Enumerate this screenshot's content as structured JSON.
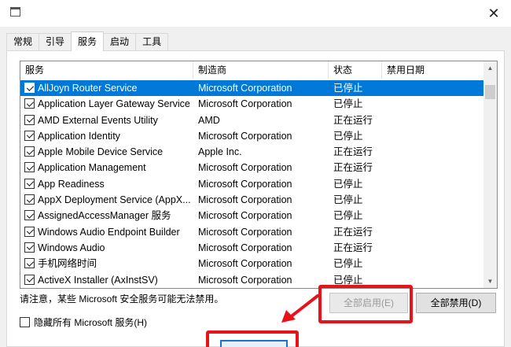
{
  "window": {
    "close_glyph": "✕"
  },
  "tabs": [
    {
      "label": "常规"
    },
    {
      "label": "引导"
    },
    {
      "label": "服务"
    },
    {
      "label": "启动"
    },
    {
      "label": "工具"
    }
  ],
  "columns": {
    "service": "服务",
    "manufacturer": "制造商",
    "status": "状态",
    "disabled_date": "禁用日期"
  },
  "services": [
    {
      "name": "AllJoyn Router Service",
      "maker": "Microsoft Corporation",
      "status": "已停止",
      "date": "",
      "checked": true
    },
    {
      "name": "Application Layer Gateway Service",
      "maker": "Microsoft Corporation",
      "status": "已停止",
      "date": "",
      "checked": true
    },
    {
      "name": "AMD External Events Utility",
      "maker": "AMD",
      "status": "正在运行",
      "date": "",
      "checked": true
    },
    {
      "name": "Application Identity",
      "maker": "Microsoft Corporation",
      "status": "已停止",
      "date": "",
      "checked": true
    },
    {
      "name": "Apple Mobile Device Service",
      "maker": "Apple Inc.",
      "status": "正在运行",
      "date": "",
      "checked": true
    },
    {
      "name": "Application Management",
      "maker": "Microsoft Corporation",
      "status": "正在运行",
      "date": "",
      "checked": true
    },
    {
      "name": "App Readiness",
      "maker": "Microsoft Corporation",
      "status": "已停止",
      "date": "",
      "checked": true
    },
    {
      "name": "AppX Deployment Service (AppX...",
      "maker": "Microsoft Corporation",
      "status": "已停止",
      "date": "",
      "checked": true
    },
    {
      "name": "AssignedAccessManager 服务",
      "maker": "Microsoft Corporation",
      "status": "已停止",
      "date": "",
      "checked": true
    },
    {
      "name": "Windows Audio Endpoint Builder",
      "maker": "Microsoft Corporation",
      "status": "正在运行",
      "date": "",
      "checked": true
    },
    {
      "name": "Windows Audio",
      "maker": "Microsoft Corporation",
      "status": "正在运行",
      "date": "",
      "checked": true
    },
    {
      "name": "手机网络时间",
      "maker": "Microsoft Corporation",
      "status": "已停止",
      "date": "",
      "checked": true
    },
    {
      "name": "ActiveX Installer (AxInstSV)",
      "maker": "Microsoft Corporation",
      "status": "已停止",
      "date": "",
      "checked": true
    }
  ],
  "note": "请注意，某些 Microsoft 安全服务可能无法禁用。",
  "hide_ms_label": "隐藏所有 Microsoft 服务(H)",
  "buttons": {
    "enable_all": "全部启用(E)",
    "disable_all": "全部禁用(D)"
  },
  "colors": {
    "selection": "#0078d7",
    "highlight": "#e8121b"
  },
  "icons": {
    "scroll_up": "▲",
    "scroll_down": "▼"
  }
}
